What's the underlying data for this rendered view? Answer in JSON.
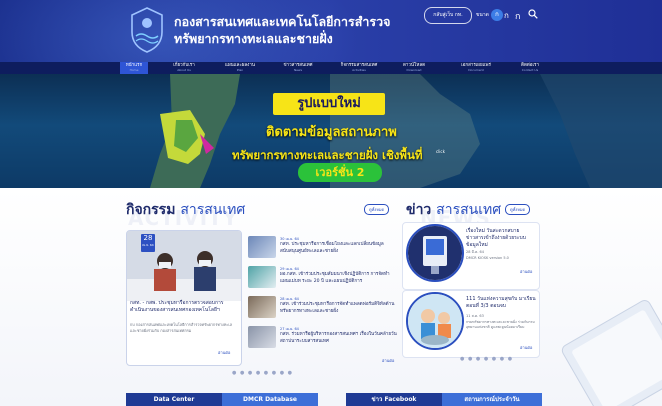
{
  "header": {
    "title_line1": "กองสารสนเทศและเทคโนโลยีการสำรวจ",
    "title_line2": "ทรัพยากรทางทะเลและชายฝั่ง",
    "back_button": "กลับสู่เว็บ กท.",
    "font_size_label": "ขนาด",
    "font_sizes": [
      "ก",
      "ก",
      "ก"
    ],
    "search_icon": "search-icon"
  },
  "nav": {
    "items": [
      {
        "label": "หน้าแรก",
        "en": "Home"
      },
      {
        "label": "เกี่ยวกับเรา",
        "en": "About Us"
      },
      {
        "label": "แผนและผลงาน",
        "en": "Plan"
      },
      {
        "label": "ข่าวสารสนเทศ",
        "en": "News"
      },
      {
        "label": "กิจกรรมสารสนเทศ",
        "en": "Activities"
      },
      {
        "label": "ดาวน์โหลด",
        "en": "Download"
      },
      {
        "label": "เอกสารเผยแพร่",
        "en": "Document"
      },
      {
        "label": "ติดต่อเรา",
        "en": "Contact Us"
      }
    ],
    "active_index": 0
  },
  "hero": {
    "line1": "รูปแบบใหม่",
    "line2": "ติดตามข้อมูลสถานภาพ",
    "line3": "ทรัพยากรทางทะเลและชายฝั่ง เชิงพื้นที่",
    "version": "เวอร์ชั่น 2",
    "click_hint": "click"
  },
  "activities": {
    "title_bold": "กิจกรรม",
    "title_rest": "สารสนเทศ",
    "watermark": "ACTIVITY",
    "more": "ดูทั้งหมด",
    "feature": {
      "day": "28",
      "month": "เม.ย. 64",
      "title": "กสท. - กสพ. ประชุมหารือการตรวจสอบการดำเนินงานของสารสนเทศกองเทคโนโลยีฯ",
      "sub": "กบ กองสารสนเทศและเทคโนโลยีการสำรวจทรัพยากรทางทะเลและชายฝั่งร่วมกับ กองสารสนเทศกรม",
      "read": "อ่านต่อ"
    },
    "items": [
      {
        "date": "30 เม.ย. 64",
        "text": "กสท. ประชุมหารือการเชื่อมโยงและแลกเปลี่ยนข้อมูลสนับสนุนศูนย์ทะเลและชายฝั่ง"
      },
      {
        "date": "29 เม.ย. 64",
        "text": "ผอ.กสท. เข้าร่วมประชุมสัมมนาเชิงปฏิบัติการ การจัดทำแผนแม่บท ระยะ 20 ปี และแผนปฏิบัติการ"
      },
      {
        "date": "28 เม.ย. 64",
        "text": "กสท. เข้าร่วมประชุมหารือการจัดทำแพลตฟอร์มดิจิทัลด้านทรัพยากรทางทะเลและชายฝั่ง"
      },
      {
        "date": "27 เม.ย. 64",
        "text": "กสท. ร่วมหารือผู้บริหารกองสารสนเทศฯ เรื่องในวันคล้ายวันสถาปนาระบบสารสนเทศ"
      }
    ],
    "read": "อ่านต่อ"
  },
  "news": {
    "title_bold": "ข่าว",
    "title_rest": "สารสนเทศ",
    "watermark": "NEWS",
    "more": "ดูทั้งหมด",
    "cards": [
      {
        "title": "เรื่องใหม่ วันสะดวกสบาย ข่าวสารเข้าถึงง่ายด้วยระบบข้อมูลใหม่",
        "meta": "28 มี.ค. 64",
        "caption": "DMCR KIOSK version 5.0",
        "read": "อ่านต่อ"
      },
      {
        "title": "111 วันแห่งความสุขกับ มาเรียน ตอนที่ 3/3 ตอนจบ",
        "meta": "11 ส.ค. 63",
        "caption": "กรมทรัพยากรทางทะเลและชายฝั่ง ร่วมกับกรมอุทยานแห่งชาติ ดูแลพะยูนน้อยมาเรียม",
        "read": "อ่านต่อ"
      }
    ]
  },
  "bottom_tabs": [
    "Data Center",
    "DMCR Database",
    "ข่าว Facebook",
    "สถานการณ์ประจำวัน"
  ],
  "colors": {
    "brand": "#1f2f96",
    "accent": "#2b4fbf",
    "hero_yellow": "#f7e417",
    "hero_green": "#2bc23a"
  }
}
